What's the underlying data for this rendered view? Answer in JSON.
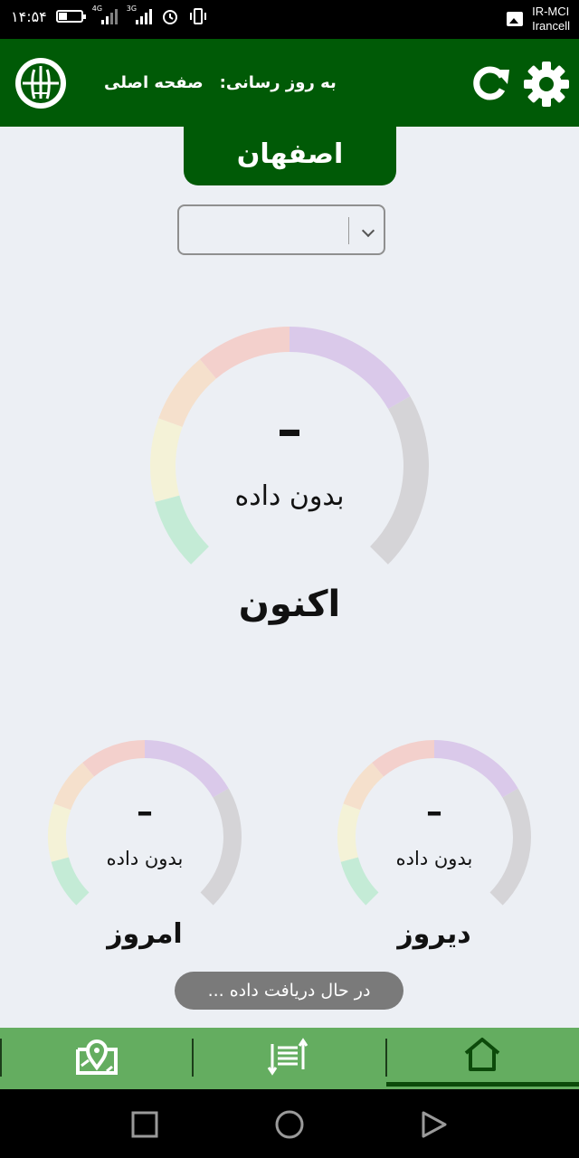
{
  "status_bar": {
    "time": "۱۴:۵۴",
    "battery_level": 0.35,
    "network_1": "4G",
    "network_2": "3G",
    "carrier_1": "IR-MCI",
    "carrier_2": "Irancell"
  },
  "header": {
    "update_label": "به روز رسانی:",
    "page_name": "صفحه اصلی",
    "refresh_icon": "refresh-icon",
    "settings_icon": "gear-icon",
    "logo_icon": "organization-logo"
  },
  "city": {
    "name": "اصفهان"
  },
  "station_select": {
    "value": ""
  },
  "gauges": {
    "now": {
      "value": "–",
      "status": "بدون داده",
      "label": "اکنون"
    },
    "today": {
      "value": "–",
      "status": "بدون داده",
      "label": "امروز"
    },
    "yesterday": {
      "value": "–",
      "status": "بدون داده",
      "label": "دیروز"
    }
  },
  "gauge_colors": [
    "#c4ebd6",
    "#f4f2d7",
    "#f5e0cc",
    "#f3d0cc",
    "#dac9ea",
    "#d5d4d7"
  ],
  "toast": {
    "text": "در حال دریافت داده ..."
  },
  "bottom_nav": {
    "items": [
      {
        "icon": "map-icon"
      },
      {
        "icon": "sort-icon"
      },
      {
        "icon": "home-icon"
      }
    ],
    "active": "home"
  },
  "system_nav": {
    "recent_icon": "square-icon",
    "home_icon": "circle-icon",
    "back_icon": "triangle-icon"
  }
}
